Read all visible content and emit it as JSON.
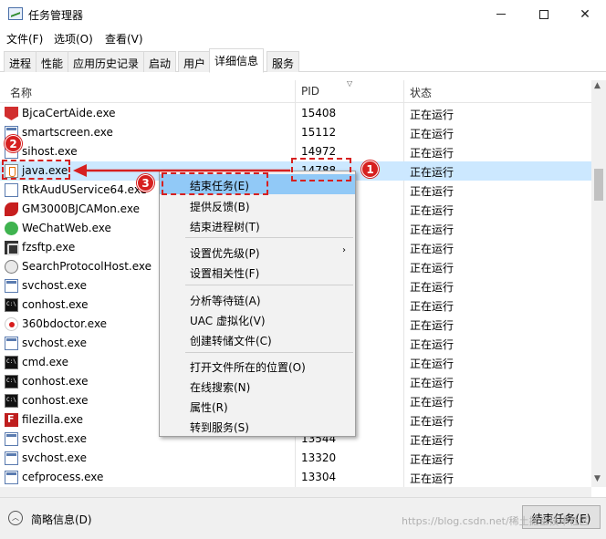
{
  "window": {
    "title": "任务管理器",
    "controls": {
      "minimize": "—",
      "maximize": "☐",
      "close": "✕"
    }
  },
  "menu": [
    "文件(F)",
    "选项(O)",
    "查看(V)"
  ],
  "tabs": [
    "进程",
    "性能",
    "应用历史记录",
    "启动",
    "用户",
    "详细信息",
    "服务"
  ],
  "active_tab": "详细信息",
  "table": {
    "columns": {
      "name": "名称",
      "pid": "PID",
      "status": "状态"
    },
    "rows": [
      {
        "name": "BjcaCertAide.exe",
        "pid": "15408",
        "status": "正在运行",
        "icon": "red-shield-icon"
      },
      {
        "name": "smartscreen.exe",
        "pid": "15112",
        "status": "正在运行",
        "icon": "exe-icon"
      },
      {
        "name": "sihost.exe",
        "pid": "14972",
        "status": "正在运行",
        "icon": "exe-icon"
      },
      {
        "name": "java.exe",
        "pid": "14788",
        "status": "正在运行",
        "icon": "java-icon",
        "selected": true
      },
      {
        "name": "RtkAudUService64.exe",
        "pid": "",
        "status": "正在运行",
        "icon": "realtek-icon"
      },
      {
        "name": "GM3000BJCAMon.exe",
        "pid": "",
        "status": "正在运行",
        "icon": "gm-icon"
      },
      {
        "name": "WeChatWeb.exe",
        "pid": "",
        "status": "正在运行",
        "icon": "wechat-icon"
      },
      {
        "name": "fzsftp.exe",
        "pid": "",
        "status": "正在运行",
        "icon": "ftp-icon"
      },
      {
        "name": "SearchProtocolHost.exe",
        "pid": "",
        "status": "正在运行",
        "icon": "search-icon"
      },
      {
        "name": "svchost.exe",
        "pid": "",
        "status": "正在运行",
        "icon": "exe-icon"
      },
      {
        "name": "conhost.exe",
        "pid": "",
        "status": "正在运行",
        "icon": "console-icon"
      },
      {
        "name": "360bdoctor.exe",
        "pid": "",
        "status": "正在运行",
        "icon": "360-icon"
      },
      {
        "name": "svchost.exe",
        "pid": "",
        "status": "正在运行",
        "icon": "exe-icon"
      },
      {
        "name": "cmd.exe",
        "pid": "",
        "status": "正在运行",
        "icon": "console-icon"
      },
      {
        "name": "conhost.exe",
        "pid": "",
        "status": "正在运行",
        "icon": "console-icon"
      },
      {
        "name": "conhost.exe",
        "pid": "",
        "status": "正在运行",
        "icon": "console-icon"
      },
      {
        "name": "filezilla.exe",
        "pid": "",
        "status": "正在运行",
        "icon": "filezilla-icon"
      },
      {
        "name": "svchost.exe",
        "pid": "13544",
        "status": "正在运行",
        "icon": "exe-icon"
      },
      {
        "name": "svchost.exe",
        "pid": "13320",
        "status": "正在运行",
        "icon": "exe-icon"
      },
      {
        "name": "cefprocess.exe",
        "pid": "13304",
        "status": "正在运行",
        "icon": "exe-icon"
      }
    ]
  },
  "context_menu": {
    "items": [
      {
        "label": "结束任务(E)",
        "highlighted": true
      },
      {
        "label": "提供反馈(B)"
      },
      {
        "label": "结束进程树(T)"
      },
      {
        "label": "设置优先级(P)",
        "submenu": true
      },
      {
        "label": "设置相关性(F)"
      },
      {
        "label": "分析等待链(A)"
      },
      {
        "label": "UAC 虚拟化(V)"
      },
      {
        "label": "创建转储文件(C)"
      },
      {
        "label": "打开文件所在的位置(O)"
      },
      {
        "label": "在线搜索(N)"
      },
      {
        "label": "属性(R)"
      },
      {
        "label": "转到服务(S)"
      }
    ],
    "submenu_arrow": "›"
  },
  "annotations": {
    "badge1": "1",
    "badge2": "2",
    "badge3": "3",
    "accent": "#d62020"
  },
  "footer": {
    "fewer_details": "简略信息(D)",
    "end_task": "结束任务(E)",
    "watermark": "https://blog.csdn.net/稀土掘金技术社区"
  }
}
